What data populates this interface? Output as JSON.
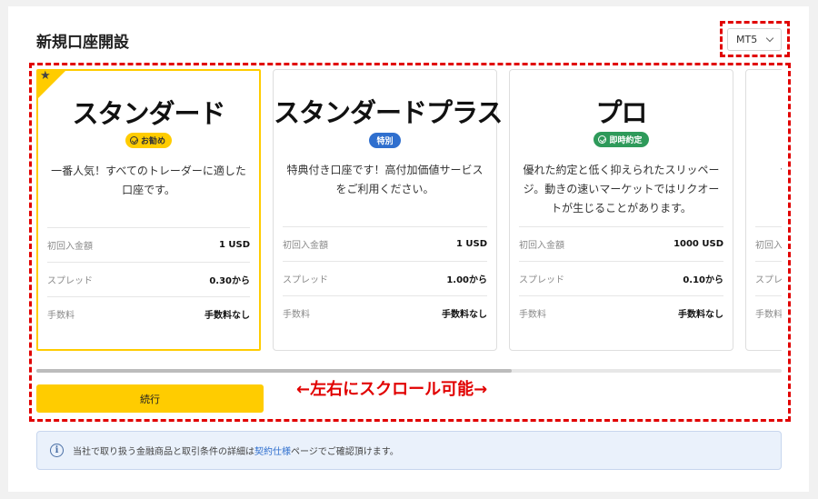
{
  "header": {
    "title": "新規口座開設"
  },
  "platform_select": {
    "value": "MT5"
  },
  "cards": [
    {
      "title": "スタンダード",
      "badge": "お勧め",
      "badge_bg": "#ffcc00",
      "badge_color": "#333333",
      "badge_icon": "check-circle-icon",
      "description": "一番人気！すべてのトレーダーに適した口座です。",
      "selected": true,
      "rows": [
        {
          "label": "初回入金額",
          "value": "1 USD"
        },
        {
          "label": "スプレッド",
          "value": "0.30から"
        },
        {
          "label": "手数料",
          "value": "手数料なし"
        }
      ]
    },
    {
      "title": "スタンダードプラス",
      "badge": "特別",
      "badge_bg": "#2f6fce",
      "badge_color": "#ffffff",
      "badge_icon": "",
      "description": "特典付き口座です！高付加価値サービスをご利用ください。",
      "selected": false,
      "rows": [
        {
          "label": "初回入金額",
          "value": "1 USD"
        },
        {
          "label": "スプレッド",
          "value": "1.00から"
        },
        {
          "label": "手数料",
          "value": "手数料なし"
        }
      ]
    },
    {
      "title": "プロ",
      "badge": "即時約定",
      "badge_bg": "#2e9a5a",
      "badge_color": "#ffffff",
      "badge_icon": "check-circle-icon",
      "description": "優れた約定と低く抑えられたスリッページ。動きの速いマーケットではリクオートが生じることがあります。",
      "selected": false,
      "rows": [
        {
          "label": "初回入金額",
          "value": "1000 USD"
        },
        {
          "label": "スプレッド",
          "value": "0.10から"
        },
        {
          "label": "手数料",
          "value": "手数料なし"
        }
      ]
    },
    {
      "title": "",
      "badge": "",
      "description": "優",
      "selected": false,
      "rows": [
        {
          "label": "初回入",
          "value": ""
        },
        {
          "label": "スプレ",
          "value": ""
        },
        {
          "label": "手数料",
          "value": ""
        }
      ]
    }
  ],
  "continue_button": {
    "label": "続行"
  },
  "scroll_note": "←左右にスクロール可能→",
  "info": {
    "text_before": "当社で取り扱う金融商品と取引条件の詳細は",
    "link_text": "契約仕様",
    "text_after": "ページでご確認頂けます。",
    "icon": "info-icon"
  },
  "colors": {
    "accent": "#ffcc00",
    "annotation": "#e10000",
    "link": "#2f6fce"
  }
}
